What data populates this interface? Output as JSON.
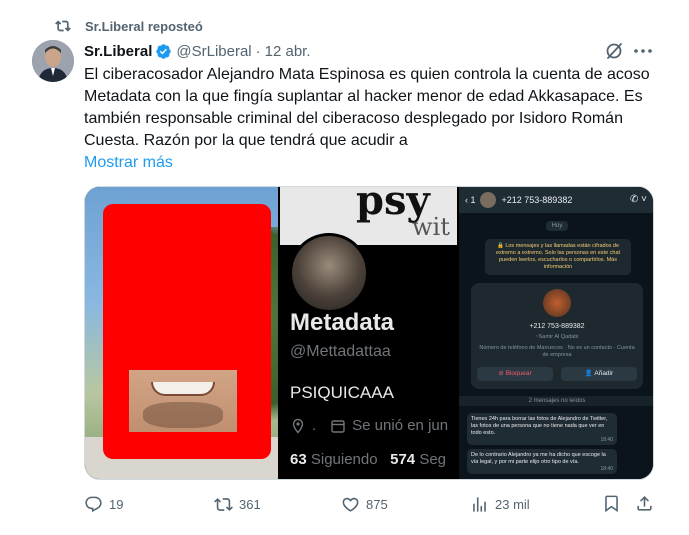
{
  "repost_banner": {
    "text": "Sr.Liberal reposteó",
    "icon": "repost-icon"
  },
  "tweet": {
    "author_name": "Sr.Liberal",
    "author_handle": "@SrLiberal",
    "separator": "·",
    "date": "12 abr.",
    "text": "El ciberacosador Alejandro Mata Espinosa es quien controla la cuenta de acoso Metadata con la que fingía suplantar al hacker menor de edad Akkasapace. Es también responsable criminal del ciberacoso desplegado por Isidoro Román Cuesta. Razón por la que tendrá que acudir a",
    "show_more": "Mostrar más"
  },
  "media": {
    "profile": {
      "banner_text_1": "psy",
      "banner_text_2": "wit",
      "name": "Metadata",
      "handle": "@Mettadattaa",
      "bio": "PSIQUICAAA",
      "location": ".",
      "joined": "Se unió en jun",
      "following_count": "63",
      "following_label": "Siguiendo",
      "followers_count": "574",
      "followers_label": "Seg"
    },
    "chat": {
      "back": "‹ 1",
      "phone": "+212 753-889382",
      "call_icon": "✆ ˅",
      "day": "Hoy",
      "encryption": "🔒 Los mensajes y las llamadas están cifrados de extremo a extremo. Solo las personas en este chat pueden leerlos, escucharlos o compartirlos. Más información",
      "card_number": "+212 753-889382",
      "card_name": "~Samir Al Qadabi",
      "card_info": "Número de teléfono de Marruecos · No es un contacto · Cuenta de empresa",
      "block_label": "⊘ Bloquear",
      "add_label": "👤 Añadir",
      "unread": "2 mensajes no leídos",
      "messages": [
        {
          "text": "Tienes 24h para borrar las fotos de Alejandro de Twitter, las fotos de una persona que no tiene nada que ver en todo esto.",
          "time": "18:40"
        },
        {
          "text": "De lo contrario Alejandro ya me ha dicho que escoge la vía legal, y por mi parte elijo otro tipo de vía.",
          "time": "18:40"
        }
      ]
    }
  },
  "actions": {
    "replies": "19",
    "reposts": "361",
    "likes": "875",
    "views": "23 mil"
  },
  "colors": {
    "accent": "#1d9bf0",
    "secondary_text": "#536471",
    "verified": "#1d9bf0",
    "redaction": "#ff0000"
  }
}
